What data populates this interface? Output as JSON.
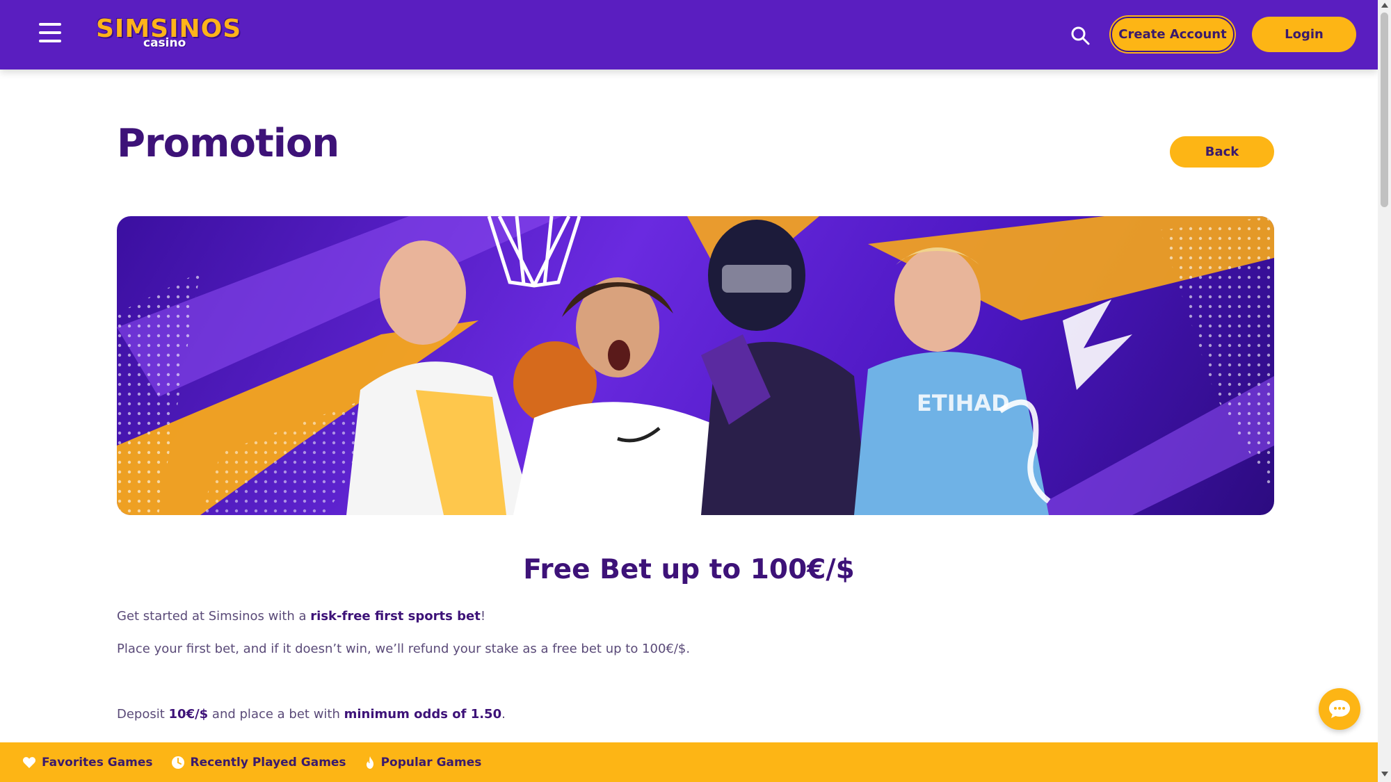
{
  "header": {
    "logo_main": "SIMSINOS",
    "logo_sub": "casino",
    "menu_icon": "hamburger-menu-icon",
    "search_icon": "search-icon",
    "create_account_label": "Create Account",
    "login_label": "Login"
  },
  "page": {
    "title": "Promotion",
    "back_label": "Back"
  },
  "promo": {
    "heading": "Free Bet up to 100€/$",
    "p1_pre": "Get started at Simsinos with a ",
    "p1_bold": "risk-free first sports bet",
    "p1_post": "!",
    "p2": "Place your first bet, and if it doesn’t win, we’ll refund your stake as a free bet up to 100€/$.",
    "p3_pre": "Deposit ",
    "p3_bold1": "10€/$",
    "p3_mid": " and place a bet with ",
    "p3_bold2": "minimum odds of 1.50",
    "p3_post": "."
  },
  "chat": {
    "icon": "chat-bubble-icon"
  },
  "bottom_bar": {
    "favorites_label": "Favorites Games",
    "recent_label": "Recently Played Games",
    "popular_label": "Popular Games"
  },
  "colors": {
    "header_bg": "#5a1ec0",
    "accent": "#fdb515",
    "title_text": "#3d1278"
  }
}
